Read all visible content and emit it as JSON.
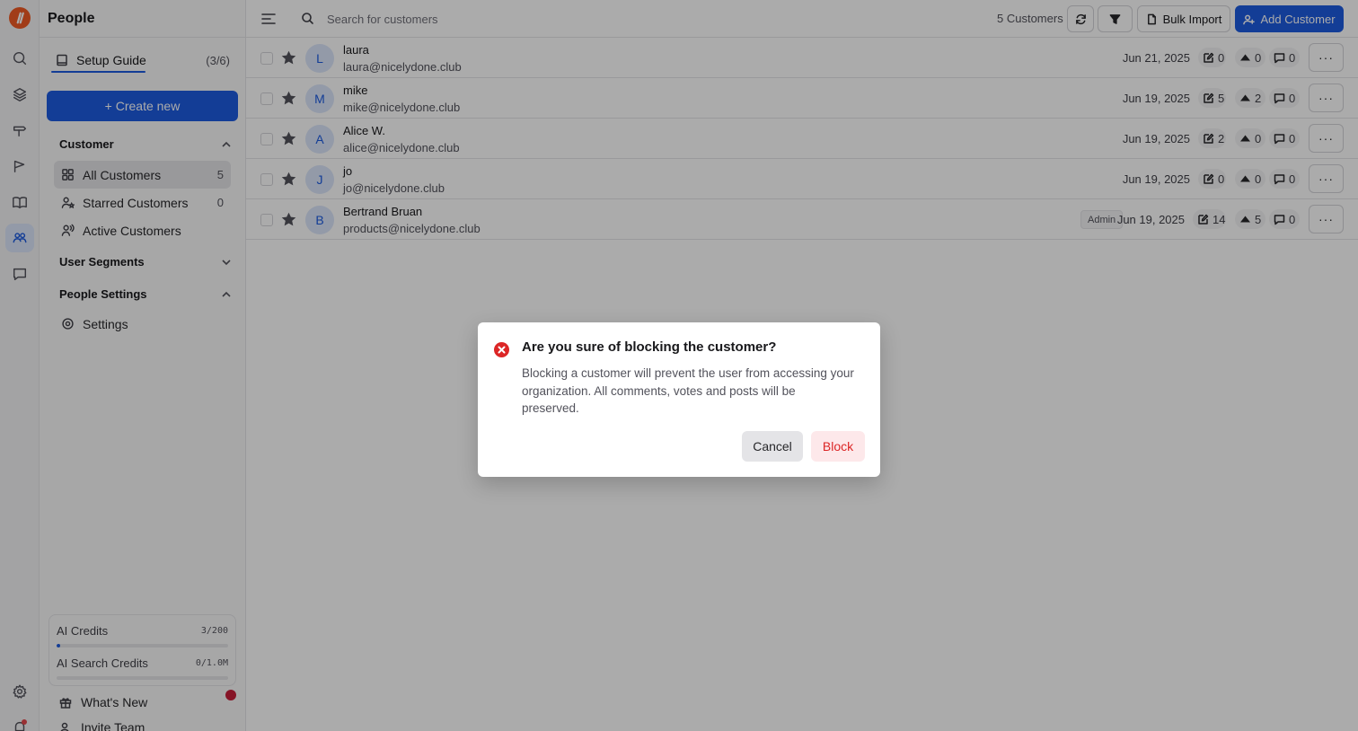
{
  "app": {
    "section_title": "People"
  },
  "sidebar": {
    "setup_guide": {
      "label": "Setup Guide",
      "progress": "(3/6)"
    },
    "create_new": "+ Create new",
    "sections": {
      "customer": "Customer",
      "user_segments": "User Segments",
      "people_settings": "People Settings"
    },
    "items": [
      {
        "label": "All Customers",
        "count": "5"
      },
      {
        "label": "Starred Customers",
        "count": "0"
      },
      {
        "label": "Active Customers",
        "count": ""
      }
    ],
    "settings_label": "Settings",
    "credits": [
      {
        "label": "AI Credits",
        "value": "3/200",
        "fraction": 0.015
      },
      {
        "label": "AI Search Credits",
        "value": "0/1.0M",
        "fraction": 0
      }
    ],
    "whats_new": "What's New",
    "invite_team": "Invite Team"
  },
  "toolbar": {
    "search_placeholder": "Search for customers",
    "count": "5 Customers",
    "bulk_import": "Bulk Import",
    "add_customer": "Add Customer"
  },
  "customers": [
    {
      "initial": "L",
      "name": "laura",
      "email": "laura@nicelydone.club",
      "date": "Jun 21, 2025",
      "posts": "0",
      "votes": "0",
      "comments": "0",
      "admin": ""
    },
    {
      "initial": "M",
      "name": "mike",
      "email": "mike@nicelydone.club",
      "date": "Jun 19, 2025",
      "posts": "5",
      "votes": "2",
      "comments": "0",
      "admin": ""
    },
    {
      "initial": "A",
      "name": "Alice W.",
      "email": "alice@nicelydone.club",
      "date": "Jun 19, 2025",
      "posts": "2",
      "votes": "0",
      "comments": "0",
      "admin": ""
    },
    {
      "initial": "J",
      "name": "jo",
      "email": "jo@nicelydone.club",
      "date": "Jun 19, 2025",
      "posts": "0",
      "votes": "0",
      "comments": "0",
      "admin": ""
    },
    {
      "initial": "B",
      "name": "Bertrand Bruan",
      "email": "products@nicelydone.club",
      "date": "Jun 19, 2025",
      "posts": "14",
      "votes": "5",
      "comments": "0",
      "admin": "Admin"
    }
  ],
  "row_more": "···",
  "dialog": {
    "title": "Are you sure of blocking the customer?",
    "body": "Blocking a customer will prevent the user from accessing your organization. All comments, votes and posts will be preserved.",
    "cancel": "Cancel",
    "confirm": "Block"
  },
  "colors": {
    "accent": "#1d5be0",
    "danger": "#dc2626",
    "brand": "#f15a24"
  }
}
